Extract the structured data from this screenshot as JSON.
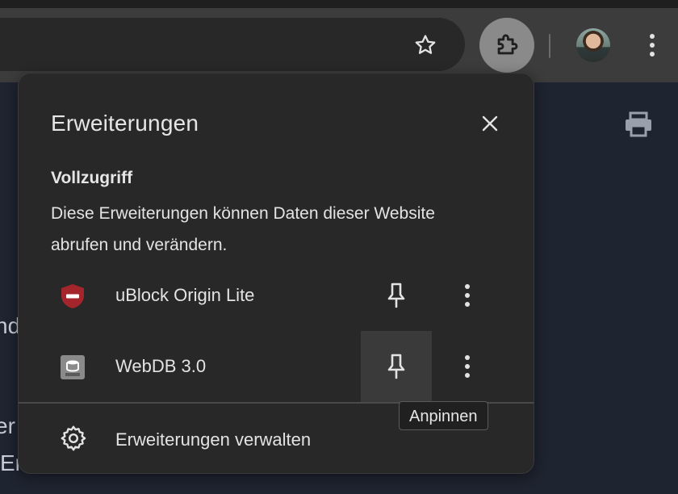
{
  "popup": {
    "title": "Erweiterungen",
    "section_heading": "Vollzugriff",
    "section_desc": "Diese Erweiterungen können Daten dieser Website abrufen und verändern.",
    "extensions": [
      {
        "name": "uBlock Origin Lite",
        "icon": "ublock-shield-icon"
      },
      {
        "name": "WebDB 3.0",
        "icon": "webdb-icon"
      }
    ],
    "manage_label": "Erweiterungen verwalten"
  },
  "tooltip": {
    "text": "Anpinnen"
  },
  "background": {
    "fragments": [
      "nd",
      "er",
      "Er"
    ]
  },
  "colors": {
    "accent_shield": "#a4262c",
    "popup_bg": "#282828",
    "toolbar_bg": "#3c3c3c"
  }
}
